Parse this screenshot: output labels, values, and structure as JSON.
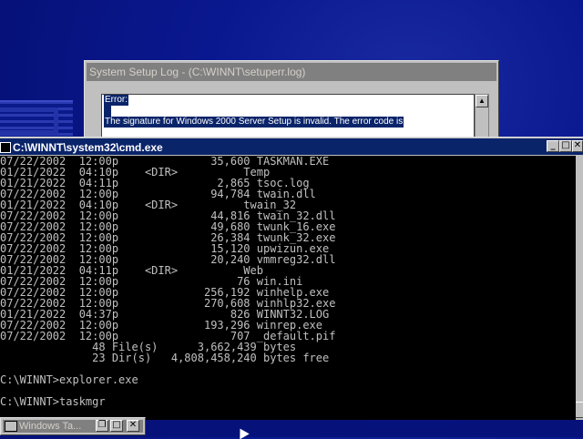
{
  "setup_log": {
    "title": "System Setup Log - (C:\\WINNT\\setuperr.log)",
    "line1": "Error:",
    "line3": "The signature for Windows 2000 Server Setup is invalid.  The error code is"
  },
  "cmd": {
    "title": "C:\\WINNT\\system32\\cmd.exe",
    "lines": [
      "07/22/2002  12:00p              35,600 TASKMAN.EXE",
      "01/21/2022  04:10p    <DIR>          Temp",
      "01/21/2022  04:11p               2,865 tsoc.log",
      "07/22/2002  12:00p              94,784 twain.dll",
      "01/21/2022  04:10p    <DIR>          twain_32",
      "07/22/2002  12:00p              44,816 twain_32.dll",
      "07/22/2002  12:00p              49,680 twunk_16.exe",
      "07/22/2002  12:00p              26,384 twunk_32.exe",
      "07/22/2002  12:00p              15,120 upwizun.exe",
      "07/22/2002  12:00p              20,240 vmmreg32.dll",
      "01/21/2022  04:11p    <DIR>          Web",
      "07/22/2002  12:00p                  76 win.ini",
      "07/22/2002  12:00p             256,192 winhelp.exe",
      "07/22/2002  12:00p             270,608 winhlp32.exe",
      "01/21/2022  04:37p                 826 WINNT32.LOG",
      "07/22/2002  12:00p             193,296 winrep.exe",
      "07/22/2002  12:00p                 707 _default.pif",
      "              48 File(s)      3,662,439 bytes",
      "              23 Dir(s)   4,808,458,240 bytes free",
      "",
      "C:\\WINNT>explorer.exe",
      "",
      "C:\\WINNT>taskmgr"
    ]
  },
  "minimized": {
    "title": "Windows Ta..."
  },
  "buttons": {
    "minimize": "_",
    "maximize": "□",
    "close": "✕",
    "restore": "❐",
    "scroll_up": "▲"
  }
}
